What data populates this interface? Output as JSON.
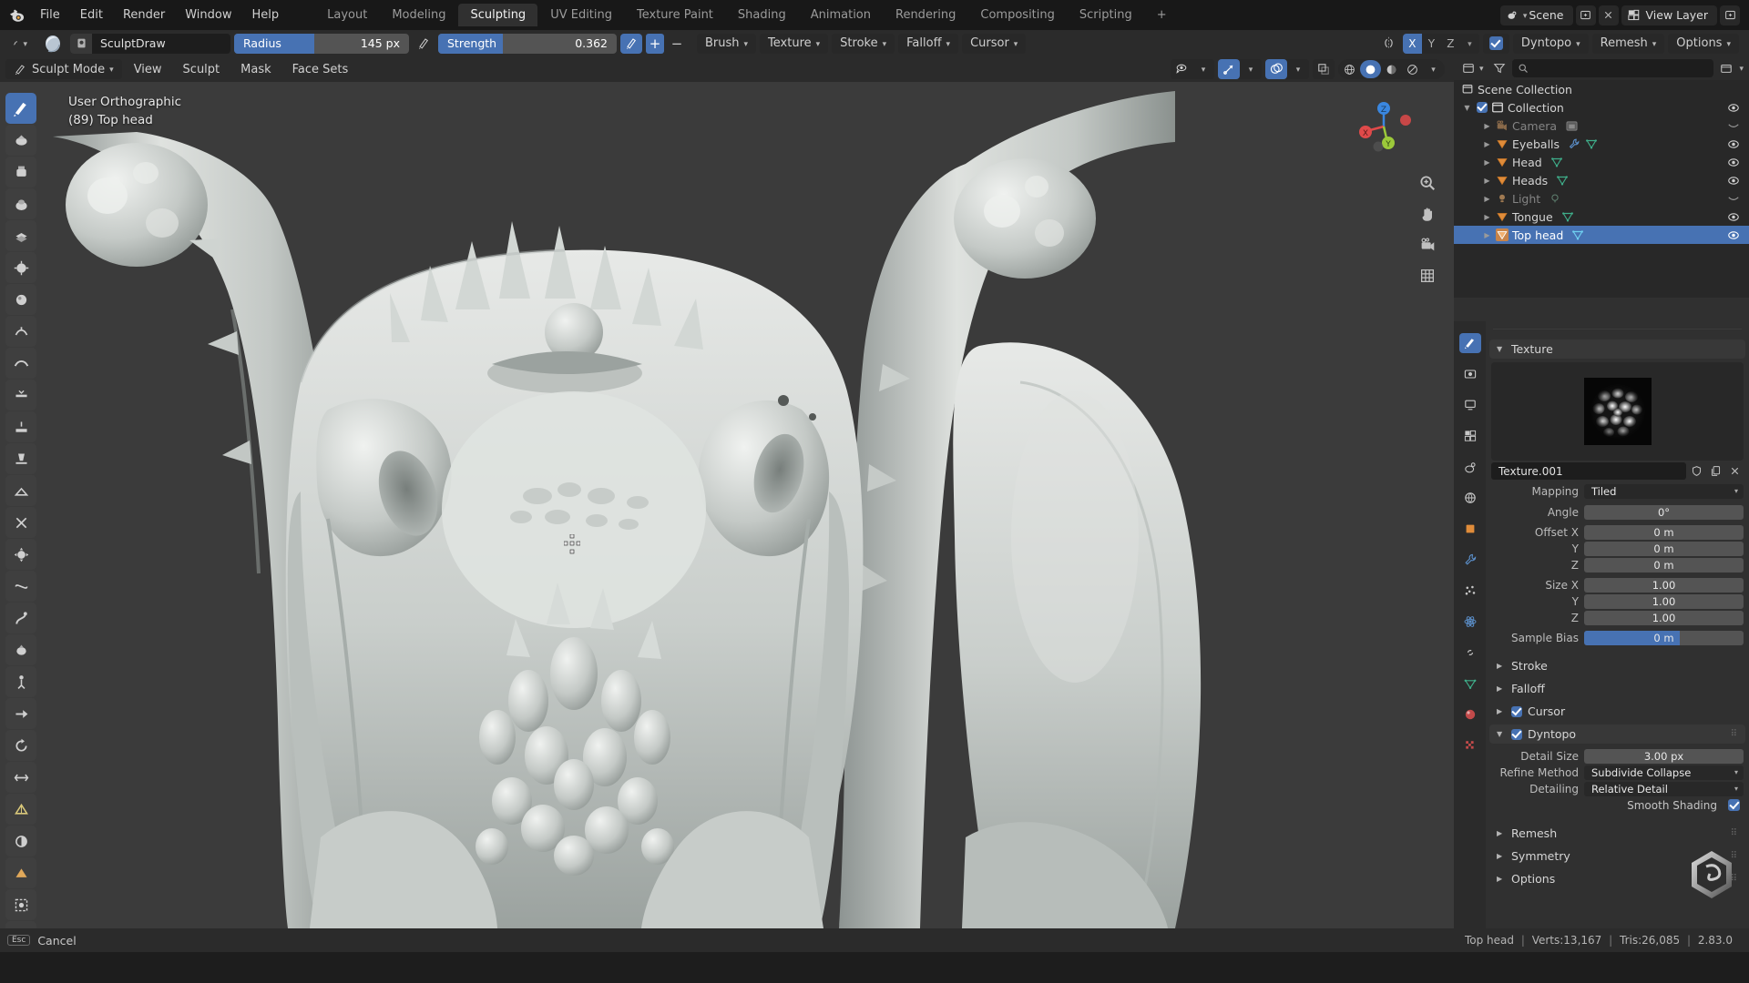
{
  "app": {
    "name": "Blender",
    "version": "2.83.0"
  },
  "topbar": {
    "logo_icon": "blender-logo-icon",
    "menus": [
      "File",
      "Edit",
      "Render",
      "Window",
      "Help"
    ],
    "workspace_tabs": [
      {
        "label": "Layout",
        "active": false
      },
      {
        "label": "Modeling",
        "active": false
      },
      {
        "label": "Sculpting",
        "active": true
      },
      {
        "label": "UV Editing",
        "active": false
      },
      {
        "label": "Texture Paint",
        "active": false
      },
      {
        "label": "Shading",
        "active": false
      },
      {
        "label": "Animation",
        "active": false
      },
      {
        "label": "Rendering",
        "active": false
      },
      {
        "label": "Compositing",
        "active": false
      },
      {
        "label": "Scripting",
        "active": false
      },
      {
        "label": "+",
        "active": false
      }
    ],
    "scene_icon": "scene-icon",
    "scene_name": "Scene",
    "new_scene_icon": "new-scene-icon",
    "unlink_scene_icon": "unlink-scene-icon",
    "viewlayer_icon": "view-layer-icon",
    "viewlayer_name": "View Layer",
    "viewlayer_new_icon": "new-view-layer-icon"
  },
  "tool_header": {
    "tool_settings_icon": "tool-settings-icon",
    "brush_preview_icon": "brush-preview-icon",
    "brush_datablock_icon": "brush-datablock-icon",
    "brush_name": "SculptDraw",
    "radius": {
      "label": "Radius",
      "value": "145 px",
      "fill_pct": 46
    },
    "radius_pressure_icon": "pressure-pen-icon",
    "strength": {
      "label": "Strength",
      "value": "0.362",
      "fill_pct": 36
    },
    "strength_pressure_icon": "pressure-pen-icon",
    "add_label": "+",
    "subtract_label": "−",
    "popovers": [
      "Brush",
      "Texture",
      "Stroke",
      "Falloff",
      "Cursor"
    ],
    "symmetry_icon": "symmetry-mirror-icon",
    "symmetry_axes": [
      {
        "label": "X",
        "on": true
      },
      {
        "label": "Y",
        "on": false
      },
      {
        "label": "Z",
        "on": false
      }
    ],
    "symmetry_chevron": "chevron-down-icon",
    "dyntopo_checked": true,
    "dyntopo_label": "Dyntopo",
    "remesh_label": "Remesh",
    "options_label": "Options"
  },
  "view_header": {
    "mode_icon": "sculpt-mode-icon",
    "mode_label": "Sculpt Mode",
    "menus": [
      "View",
      "Sculpt",
      "Mask",
      "Face Sets"
    ],
    "visibility_icon": "object-visibility-icon",
    "gizmo_icon": "gizmo-icon",
    "gizmo_on": true,
    "overlays_icon": "overlays-icon",
    "overlays_on": true,
    "xray_icon": "xray-toggle-icon",
    "shading_modes": [
      {
        "icon": "wireframe-shading-icon",
        "on": false
      },
      {
        "icon": "solid-shading-icon",
        "on": true
      },
      {
        "icon": "material-preview-shading-icon",
        "on": false
      },
      {
        "icon": "rendered-shading-icon",
        "on": false
      }
    ],
    "shading_chevron": "chevron-down-icon"
  },
  "viewport": {
    "view_name": "User Orthographic",
    "object_info": "(89) Top head",
    "cursor_icon": "3d-cursor-icon",
    "gizmo": {
      "x_label": "X",
      "y_label": "Y",
      "z_label": "Z",
      "x_color": "#e04a4a",
      "y_color": "#9cc93a",
      "z_color": "#3a87e0"
    },
    "nav_buttons": [
      "zoom-icon",
      "pan-hand-icon",
      "camera-view-icon",
      "toggle-ortho-grid-icon"
    ],
    "toolbar": [
      {
        "icon": "draw-brush-tool-icon",
        "selected": true
      },
      {
        "icon": "clay-brush-tool-icon",
        "selected": false
      },
      {
        "icon": "clay-strips-tool-icon",
        "selected": false
      },
      {
        "icon": "clay-thumb-tool-icon",
        "selected": false
      },
      {
        "icon": "layer-tool-icon",
        "selected": false
      },
      {
        "icon": "inflate-tool-icon",
        "selected": false
      },
      {
        "icon": "blob-tool-icon",
        "selected": false
      },
      {
        "icon": "crease-tool-icon",
        "selected": false
      },
      {
        "icon": "smooth-tool-icon",
        "selected": false
      },
      {
        "icon": "flatten-tool-icon",
        "selected": false
      },
      {
        "icon": "fill-tool-icon",
        "selected": false
      },
      {
        "icon": "scrape-tool-icon",
        "selected": false
      },
      {
        "icon": "multiplane-scrape-tool-icon",
        "selected": false
      },
      {
        "icon": "pinch-tool-icon",
        "selected": false
      },
      {
        "icon": "grab-tool-icon",
        "selected": false
      },
      {
        "icon": "elastic-deform-tool-icon",
        "selected": false
      },
      {
        "icon": "snake-hook-tool-icon",
        "selected": false
      },
      {
        "icon": "thumb-tool-icon",
        "selected": false
      },
      {
        "icon": "pose-tool-icon",
        "selected": false
      },
      {
        "icon": "nudge-tool-icon",
        "selected": false
      },
      {
        "icon": "rotate-tool-icon",
        "selected": false
      },
      {
        "icon": "slide-relax-tool-icon",
        "selected": false
      },
      {
        "icon": "simplify-tool-icon",
        "selected": false
      },
      {
        "icon": "mask-tool-icon",
        "selected": false
      },
      {
        "icon": "draw-face-sets-tool-icon",
        "selected": false
      },
      {
        "icon": "box-mask-tool-icon",
        "selected": false
      },
      {
        "icon": "mesh-filter-tool-icon",
        "selected": false
      }
    ]
  },
  "outliner": {
    "display_mode_icon": "outliner-display-mode-icon",
    "filter_icon": "filter-icon",
    "search_icon": "search-icon",
    "search_placeholder": "",
    "new_collection_icon": "new-collection-icon",
    "rows": [
      {
        "name": "Scene Collection",
        "icon": "scene-collection-icon",
        "depth": 0,
        "disclosure": "",
        "checkbox": false,
        "eye": false,
        "selected": false,
        "dim": false,
        "extras": []
      },
      {
        "name": "Collection",
        "icon": "collection-icon",
        "depth": 1,
        "disclosure": "down",
        "checkbox": true,
        "eye": true,
        "selected": false,
        "dim": false,
        "extras": []
      },
      {
        "name": "Camera",
        "icon": "camera-object-icon",
        "depth": 2,
        "disclosure": "right",
        "checkbox": false,
        "eye": false,
        "selected": false,
        "dim": true,
        "extras": [
          "camera-data-icon"
        ]
      },
      {
        "name": "Eyeballs",
        "icon": "mesh-object-icon",
        "depth": 2,
        "disclosure": "right",
        "checkbox": false,
        "eye": true,
        "selected": false,
        "dim": false,
        "extras": [
          "modifier-wrench-icon",
          "mesh-data-icon"
        ]
      },
      {
        "name": "Head",
        "icon": "mesh-object-icon",
        "depth": 2,
        "disclosure": "right",
        "checkbox": false,
        "eye": true,
        "selected": false,
        "dim": false,
        "extras": [
          "mesh-data-icon"
        ]
      },
      {
        "name": "Heads",
        "icon": "mesh-object-icon",
        "depth": 2,
        "disclosure": "right",
        "checkbox": false,
        "eye": true,
        "selected": false,
        "dim": false,
        "extras": [
          "mesh-data-icon"
        ]
      },
      {
        "name": "Light",
        "icon": "light-object-icon",
        "depth": 2,
        "disclosure": "right",
        "checkbox": false,
        "eye": false,
        "selected": false,
        "dim": true,
        "extras": [
          "light-data-icon"
        ]
      },
      {
        "name": "Tongue",
        "icon": "mesh-object-icon",
        "depth": 2,
        "disclosure": "right",
        "checkbox": false,
        "eye": true,
        "selected": false,
        "dim": false,
        "extras": [
          "mesh-data-icon"
        ]
      },
      {
        "name": "Top head",
        "icon": "mesh-object-icon",
        "depth": 2,
        "disclosure": "right",
        "checkbox": false,
        "eye": true,
        "selected": true,
        "dim": false,
        "extras": [
          "mesh-data-icon-active"
        ]
      }
    ]
  },
  "properties": {
    "editor_icon": "properties-editor-icon",
    "breadcrumb_icon": "tool-tab-icon",
    "tabs": [
      {
        "icon": "tool-properties-tab-icon",
        "active": true
      },
      {
        "icon": "render-properties-tab-icon",
        "active": false
      },
      {
        "icon": "output-properties-tab-icon",
        "active": false
      },
      {
        "icon": "view-layer-properties-tab-icon",
        "active": false
      },
      {
        "icon": "scene-properties-tab-icon",
        "active": false
      },
      {
        "icon": "world-properties-tab-icon",
        "active": false
      },
      {
        "icon": "object-properties-tab-icon",
        "active": false
      },
      {
        "icon": "modifier-properties-tab-icon",
        "active": false
      },
      {
        "icon": "particle-properties-tab-icon",
        "active": false
      },
      {
        "icon": "physics-properties-tab-icon",
        "active": false
      },
      {
        "icon": "constraint-properties-tab-icon",
        "active": false
      },
      {
        "icon": "data-properties-tab-icon",
        "active": false
      },
      {
        "icon": "material-properties-tab-icon",
        "active": false
      },
      {
        "icon": "texture-properties-tab-icon",
        "active": false
      }
    ],
    "texture_panel": {
      "title": "Texture",
      "expanded": true,
      "preview_icon": "texture-preview-thumbnail",
      "datablock_name": "Texture.001",
      "shield_icon": "fake-user-shield-icon",
      "copy_icon": "new-texture-copy-icon",
      "unlink_icon": "unlink-x-icon",
      "mapping_label": "Mapping",
      "mapping_value": "Tiled",
      "fields": [
        {
          "label": "Angle",
          "value": "0°",
          "type": "num"
        },
        {
          "label": "Offset X",
          "value": "0 m",
          "type": "num"
        },
        {
          "label": "Y",
          "value": "0 m",
          "type": "num"
        },
        {
          "label": "Z",
          "value": "0 m",
          "type": "num"
        },
        {
          "label": "Size X",
          "value": "1.00",
          "type": "num"
        },
        {
          "label": "Y",
          "value": "1.00",
          "type": "num"
        },
        {
          "label": "Z",
          "value": "1.00",
          "type": "num"
        },
        {
          "label": "Sample Bias",
          "value": "0 m",
          "type": "slider"
        }
      ]
    },
    "collapsed_panels": [
      {
        "title": "Stroke",
        "checkbox": null
      },
      {
        "title": "Falloff",
        "checkbox": null
      },
      {
        "title": "Cursor",
        "checkbox": true
      }
    ],
    "dyntopo_panel": {
      "title": "Dyntopo",
      "checkbox": true,
      "expanded": true,
      "fields": [
        {
          "label": "Detail Size",
          "value": "3.00 px",
          "type": "num"
        },
        {
          "label": "Refine Method",
          "value": "Subdivide Collapse",
          "type": "dropdown"
        },
        {
          "label": "Detailing",
          "value": "Relative Detail",
          "type": "dropdown"
        }
      ],
      "smooth_shading_label": "Smooth Shading",
      "smooth_shading_checked": true
    },
    "bottom_panels": [
      {
        "title": "Remesh"
      },
      {
        "title": "Symmetry"
      },
      {
        "title": "Options"
      }
    ],
    "brush_logo_icon": "sculpt-brush-logo-icon"
  },
  "statusbar": {
    "key_label": "Esc",
    "action_label": "Cancel",
    "object_name": "Top head",
    "verts_label": "Verts:13,167",
    "tris_label": "Tris:26,085",
    "version_label": "2.83.0"
  },
  "colors": {
    "accent_blue": "#4772b3",
    "panel_bg": "#303030",
    "header_bg": "#2b2b2b",
    "topbar_bg": "#181818",
    "viewport_bg": "#3b3b3b",
    "outliner_bg": "#282828"
  }
}
